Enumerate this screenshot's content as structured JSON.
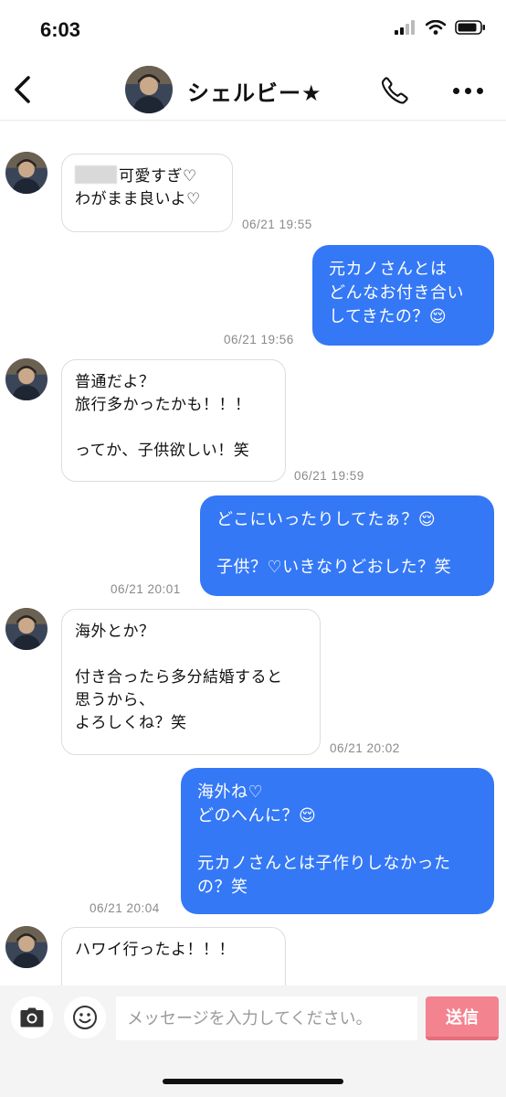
{
  "status_bar": {
    "time": "6:03"
  },
  "header": {
    "name": "シェルビー★"
  },
  "messages": [
    {
      "dir": "in",
      "lines": [
        "可愛すぎ♡",
        "わがまま良いよ♡"
      ],
      "time": "06/21 19:55"
    },
    {
      "dir": "out",
      "text": "元カノさんとは\nどんなお付き合い\nしてきたの？😌",
      "time": "06/21 19:56"
    },
    {
      "dir": "in",
      "text": "普通だよ？\n旅行多かったかも！！！\n\nってか、子供欲しい！笑",
      "time": "06/21 19:59"
    },
    {
      "dir": "out",
      "text": "どこにいったりしてたぁ？😌\n\n子供？♡いきなりどおした？笑",
      "time": "06/21 20:01"
    },
    {
      "dir": "in",
      "text": "海外とか？\n\n付き合ったら多分結婚すると\n思うから、\nよろしくね？笑",
      "time": "06/21 20:02"
    },
    {
      "dir": "out",
      "text": "海外ね♡\nどのへんに？😌\n\n元カノさんとは子作りしなかった\nの？笑",
      "time": "06/21 20:04"
    },
    {
      "dir": "in",
      "text": "ハワイ行ったよ！！！"
    }
  ],
  "input": {
    "placeholder": "メッセージを入力してください。",
    "value": ""
  },
  "send_label": "送信",
  "colors": {
    "outgoing_bubble": "#3478f6",
    "send_button": "#f3838f"
  }
}
